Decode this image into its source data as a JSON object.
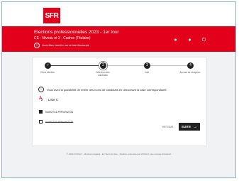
{
  "brand": {
    "logo_text": "SFR",
    "color": "#e2001a"
  },
  "header": {
    "title": "Elections professionnelles 2023 - 1er tour",
    "subtitle": "CE - Niveau et 3 - Cadres (Titulaire)",
    "link": "Vous êtes inscrit·e sur la liste électorale"
  },
  "header_icons": [
    "user-icon",
    "help-icon",
    "power-icon"
  ],
  "steps": [
    {
      "number": "✓",
      "label": "Choix élection",
      "state": "done"
    },
    {
      "number": "2",
      "label": "Sélection des candidats",
      "state": "current"
    },
    {
      "number": "3",
      "label": "Vote",
      "state": "pending"
    },
    {
      "number": "4",
      "label": "Accusé de réception",
      "state": "pending"
    }
  ],
  "instruction": "Vous avez la possibilité de retirer des noms de candidats en décochant la case correspondante.",
  "list": {
    "name": "Liste C"
  },
  "candidates": [
    {
      "name": "Nom2731 Prénom2731",
      "checked": true,
      "crossed": false
    },
    {
      "name": "Nom4736 Prénom2736",
      "checked": false,
      "crossed": true
    }
  ],
  "buttons": {
    "back": "RETOUR",
    "next": "SUITE"
  },
  "footer": "© 2023 VOXALY · Mentions légales · En Tenir de Vote · Solution proposée par VOXALY, une marque Docapost"
}
